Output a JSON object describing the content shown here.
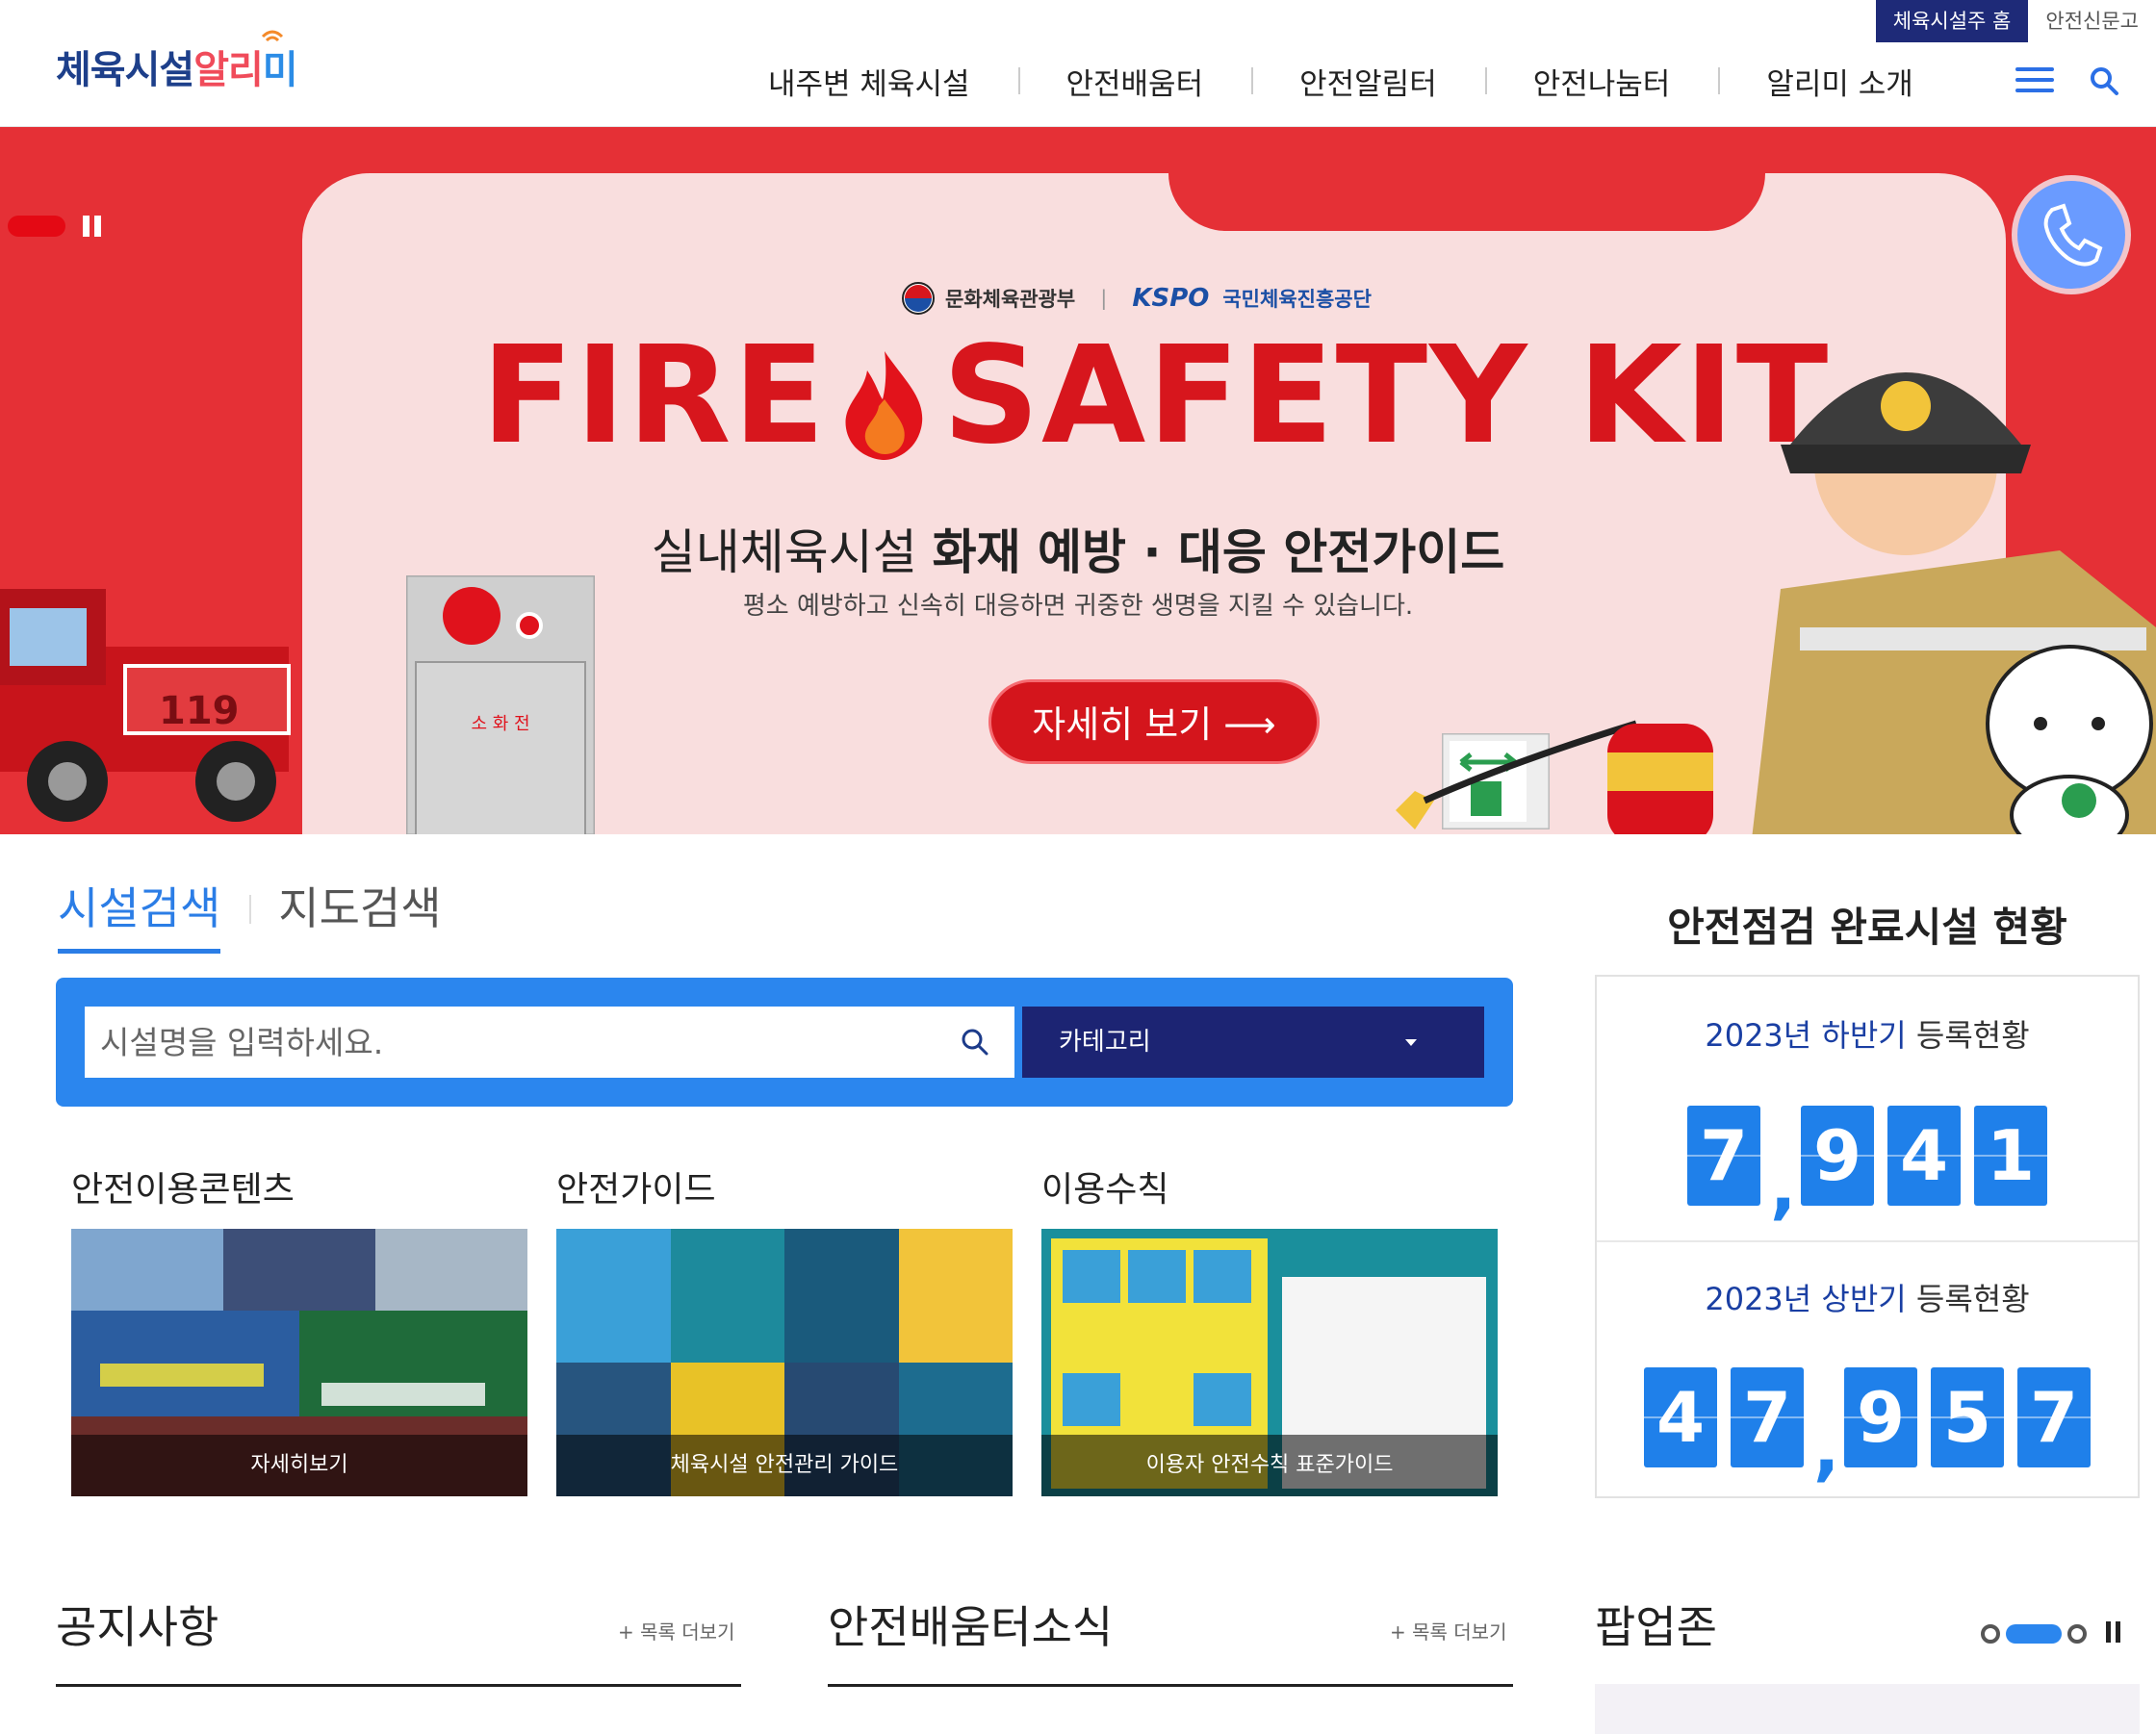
{
  "header": {
    "logo": {
      "part1": "체육시설",
      "part2": "알리",
      "part3": "미"
    },
    "util_links": [
      "체육시설주 홈",
      "안전신문고"
    ],
    "nav": [
      "내주변 체육시설",
      "안전배움터",
      "안전알림터",
      "안전나눔터",
      "알리미 소개"
    ]
  },
  "banner": {
    "org1": "문화체육관광부",
    "org2_brand": "KSPO",
    "org2": "국민체육진흥공단",
    "title_left": "FIRE",
    "title_right": "SAFETY KIT",
    "subtitle_light": "실내체육시설",
    "subtitle_bold": "화재 예방 · 대응 안전가이드",
    "desc": "평소 예방하고 신속히 대응하면 귀중한 생명을 지킬 수 있습니다.",
    "button": "자세히 보기 ⟶",
    "truck_number": "119",
    "alarm_label": "소 화 전"
  },
  "search": {
    "tabs": [
      "시설검색",
      "지도검색"
    ],
    "placeholder": "시설명을 입력하세요.",
    "category": "카테고리"
  },
  "contents": {
    "sections": [
      {
        "title": "안전이용콘텐츠",
        "caption": "자세히보기"
      },
      {
        "title": "안전가이드",
        "caption": "체육시설 안전관리 가이드"
      },
      {
        "title": "이용수칙",
        "caption": "이용자 안전수칙 표준가이드"
      }
    ]
  },
  "status": {
    "title": "안전점검 완료시설 현황",
    "h2_year": "2023년 하반기",
    "h2_suffix": "등록현황",
    "h2_digits": [
      "7",
      "9",
      "4",
      "1"
    ],
    "h1_year": "2023년 상반기",
    "h1_suffix": "등록현황",
    "h1_digits": [
      "4",
      "7",
      "9",
      "5",
      "7"
    ]
  },
  "bottom": {
    "notice_title": "공지사항",
    "notice_more": "+ 목록 더보기",
    "news_title": "안전배움터소식",
    "news_more": "+ 목록 더보기",
    "popup_title": "팝업존"
  },
  "colors": {
    "brand_blue": "#2b86ee",
    "navy": "#1c2473",
    "banner_red": "#e53036",
    "title_red": "#d7161d"
  }
}
